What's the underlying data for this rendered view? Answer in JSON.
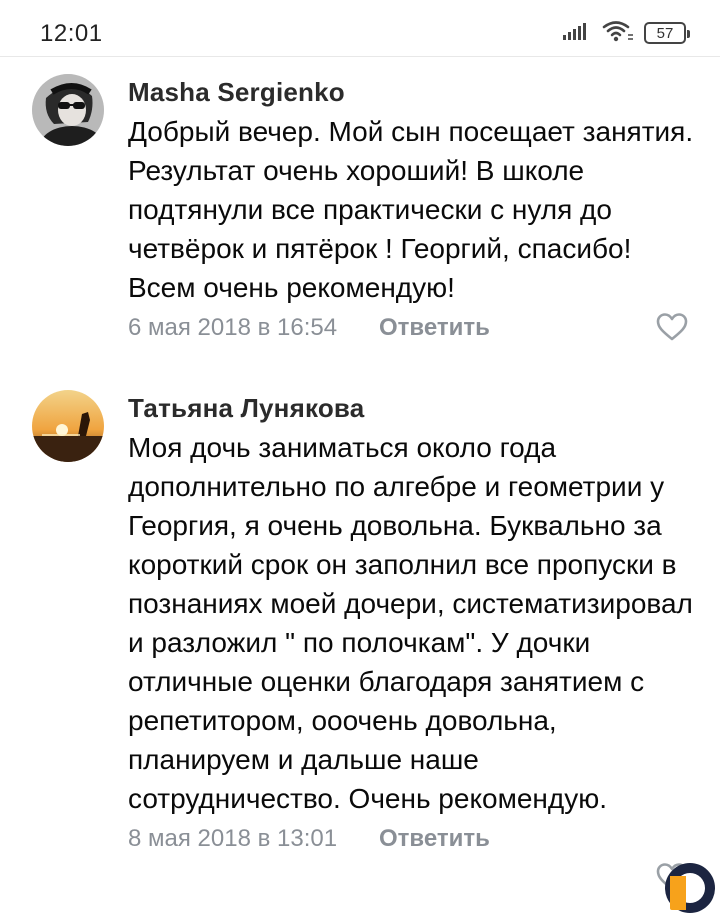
{
  "status_bar": {
    "time": "12:01",
    "battery": "57",
    "icons": [
      "signal-icon",
      "wifi-icon",
      "battery-icon"
    ]
  },
  "comments": [
    {
      "author": "Masha Sergienko",
      "text": "Добрый вечер. Мой сын посещает занятия. Результат очень хороший! В школе подтянули все практически с нуля до четвёрок и пятёрок ! Георгий, спасибо! Всем очень рекомендую!",
      "date": "6 мая 2018 в 16:54",
      "reply_label": "Ответить",
      "avatar_icon": "user-photo-avatar"
    },
    {
      "author": "Татьяна Лунякова",
      "text": "Моя дочь заниматься около года дополнительно по алгебре и геометрии у Георгия, я очень довольна. Буквально за короткий срок он заполнил все пропуски в познаниях моей дочери, систематизировал и разложил \" по полочкам\". У дочки отличные оценки благодаря занятием с репетитором, ооочень довольна, планируем и дальше наше сотрудничество. Очень рекомендую.",
      "date": "8 мая 2018 в 13:01",
      "reply_label": "Ответить",
      "avatar_icon": "sunset-photo-avatar"
    }
  ],
  "colors": {
    "meta_text": "#8a8f96",
    "like_icon": "#9aa0a6",
    "watermark_orange": "#f7a21b",
    "watermark_navy": "#1c2541"
  }
}
